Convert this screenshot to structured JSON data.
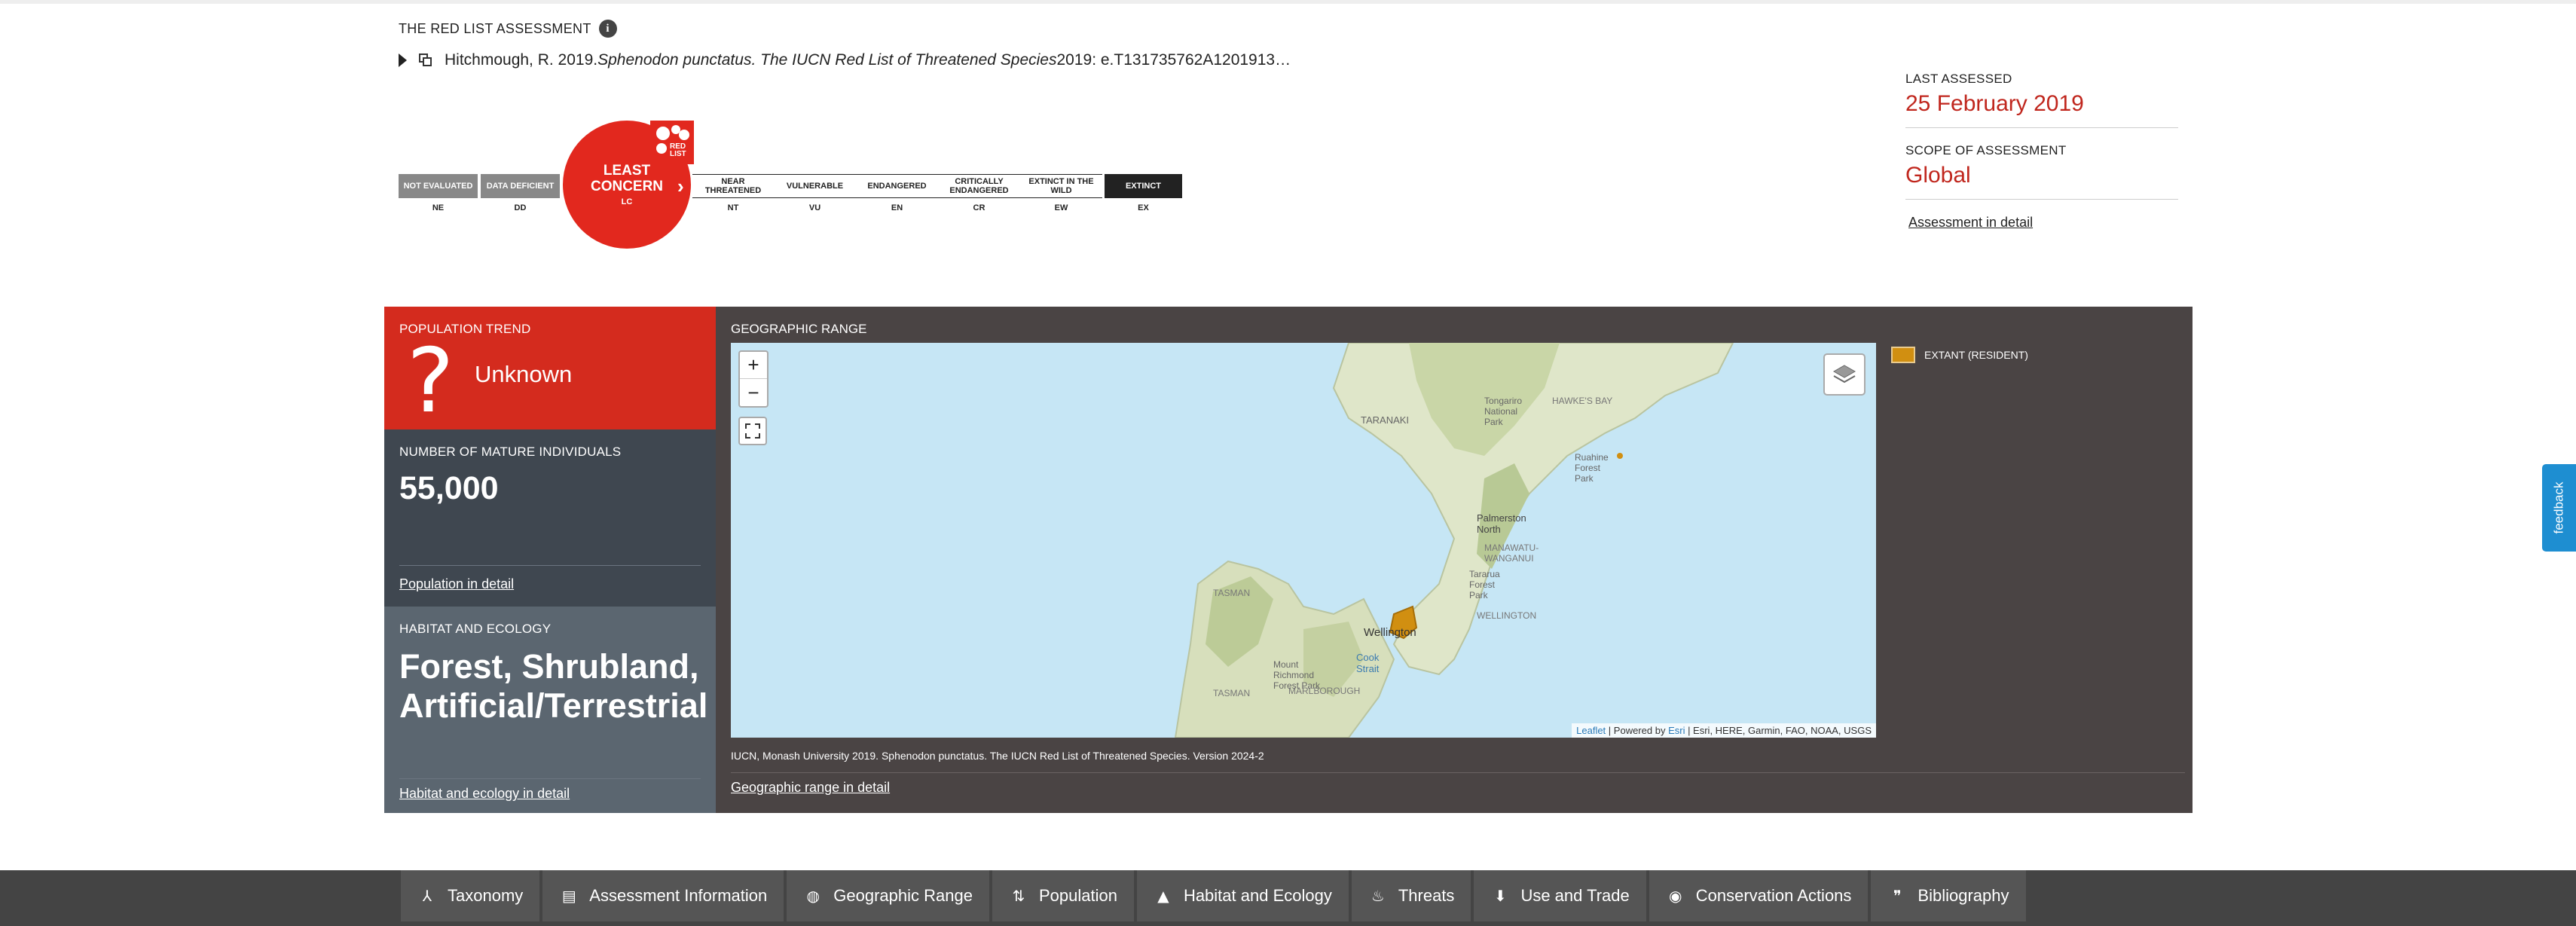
{
  "assessment": {
    "title": "THE RED LIST ASSESSMENT",
    "info_icon": "i",
    "citation_pre": "Hitchmough, R. 2019. ",
    "citation_italic": "Sphenodon punctatus. The IUCN Red List of Threatened Species",
    "citation_post": " 2019: e.T131735762A1201913…"
  },
  "scale": {
    "categories": [
      {
        "label": "NOT EVALUATED",
        "code": "NE"
      },
      {
        "label": "DATA DEFICIENT",
        "code": "DD"
      },
      {
        "label": "NEAR THREATENED",
        "code": "NT"
      },
      {
        "label": "VULNERABLE",
        "code": "VU"
      },
      {
        "label": "ENDANGERED",
        "code": "EN"
      },
      {
        "label": "CRITICALLY ENDANGERED",
        "code": "CR"
      },
      {
        "label": "EXTINCT IN THE WILD",
        "code": "EW"
      },
      {
        "label": "EXTINCT",
        "code": "EX"
      }
    ],
    "current": {
      "label": "LEAST CONCERN",
      "code": "LC",
      "color": "#e2281e"
    },
    "logo_text": "RED LIST"
  },
  "meta": {
    "last_assessed_label": "LAST ASSESSED",
    "last_assessed_value": "25 February 2019",
    "scope_label": "SCOPE OF ASSESSMENT",
    "scope_value": "Global",
    "detail_link": "Assessment in detail"
  },
  "population_trend": {
    "label": "POPULATION TREND",
    "symbol": "?",
    "value": "Unknown"
  },
  "mature": {
    "label": "NUMBER OF MATURE INDIVIDUALS",
    "value": "55,000",
    "link": "Population in detail"
  },
  "habitat": {
    "label": "HABITAT AND ECOLOGY",
    "value": "Forest, Shrubland, Artificial/Terrestrial",
    "link": "Habitat and ecology in detail"
  },
  "geo": {
    "label": "GEOGRAPHIC RANGE",
    "zoom_in": "+",
    "zoom_out": "−",
    "attribution_leaflet": "Leaflet",
    "attribution_mid": " | Powered by ",
    "attribution_esri": "Esri",
    "attribution_rest": " | Esri, HERE, Garmin, FAO, NOAA, USGS",
    "credit": "IUCN, Monash University 2019. Sphenodon punctatus. The IUCN Red List of Threatened Species. Version 2024-2",
    "link": "Geographic range in detail",
    "legend": "EXTANT (RESIDENT)",
    "legend_color": "#d18f11",
    "places": {
      "taranaki": "TARANAKI",
      "tongariro": "Tongariro National Park",
      "hawkes": "HAWKE'S BAY",
      "ruahine": "Ruahine Forest Park",
      "palmerston": "Palmerston North",
      "manawatu": "MANAWATU-WANGANUI",
      "tararua": "Tararua Forest Park",
      "wellington_region": "WELLINGTON",
      "kahurangi": "TASMAN",
      "wellington": "Wellington",
      "cook": "Cook Strait",
      "mount": "Mount Richmond Forest Park",
      "marlborough": "MARLBOROUGH",
      "tasman": "TASMAN"
    }
  },
  "nav": [
    {
      "label": "Taxonomy",
      "icon": "taxonomy-icon",
      "glyph": "⅄"
    },
    {
      "label": "Assessment Information",
      "icon": "clipboard-icon",
      "glyph": "▤"
    },
    {
      "label": "Geographic Range",
      "icon": "globe-icon",
      "glyph": "◍"
    },
    {
      "label": "Population",
      "icon": "population-arrows-icon",
      "glyph": "⇅"
    },
    {
      "label": "Habitat and Ecology",
      "icon": "mountain-icon",
      "glyph": "▲"
    },
    {
      "label": "Threats",
      "icon": "flame-icon",
      "glyph": "♨"
    },
    {
      "label": "Use and Trade",
      "icon": "hand-icon",
      "glyph": "⬇"
    },
    {
      "label": "Conservation Actions",
      "icon": "eye-icon",
      "glyph": "◉"
    },
    {
      "label": "Bibliography",
      "icon": "quote-icon",
      "glyph": "❞"
    }
  ],
  "feedback": "feedback"
}
